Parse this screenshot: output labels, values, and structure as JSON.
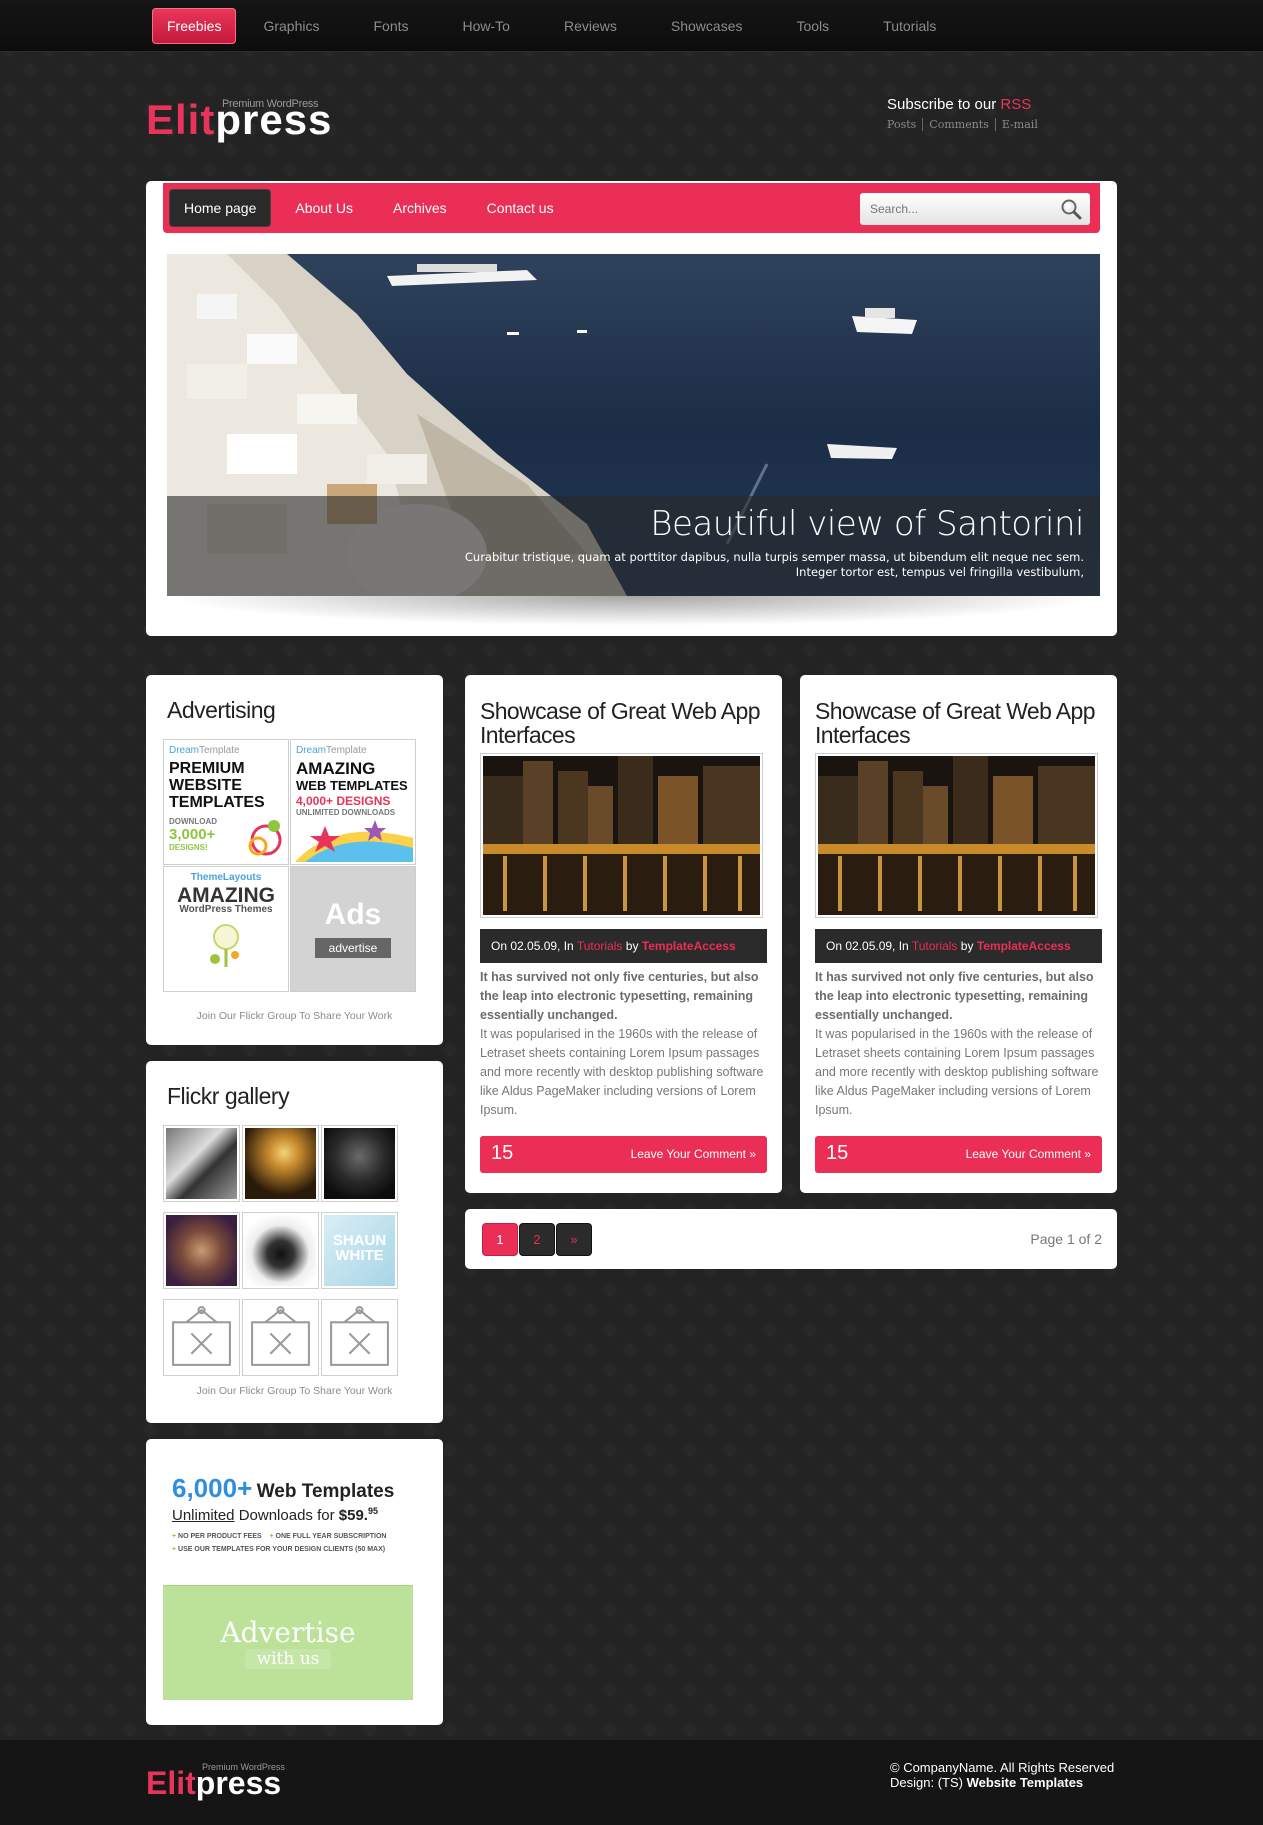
{
  "topnav": [
    "Freebies",
    "Graphics",
    "Fonts",
    "How-To",
    "Reviews",
    "Showcases",
    "Tools",
    "Tutorials"
  ],
  "logo": {
    "elit": "Elit",
    "press": "press",
    "tagline": "Premium WordPress"
  },
  "subscribe": {
    "title": "Subscribe to our",
    "rss": "RSS",
    "links": [
      "Posts",
      "Comments",
      "E-mail"
    ]
  },
  "mainnav": [
    "Home page",
    "About Us",
    "Archives",
    "Contact us"
  ],
  "search": {
    "placeholder": "Search..."
  },
  "slide": {
    "title": "Beautiful view of Santorini",
    "text": "Curabitur tristique, quam at porttitor dapibus, nulla turpis semper massa, ut bibendum elit neque nec sem. Integer tortor est, tempus vel fringilla vestibulum,"
  },
  "advertising": {
    "title": "Advertising",
    "ad1": {
      "brand": "Dream",
      "brand2": "Template",
      "line1": "PREMIUM",
      "line2": "WEBSITE",
      "line3": "TEMPLATES",
      "line4": "DOWNLOAD",
      "line5": "3,000+",
      "line6": "DESIGNS!"
    },
    "ad2": {
      "brand": "Dream",
      "brand2": "Template",
      "line1": "AMAZING",
      "line2": "WEB TEMPLATES",
      "line3": "4,000+ DESIGNS",
      "line4": "UNLIMITED DOWNLOADS"
    },
    "ad3": {
      "brand": "ThemeLayouts",
      "line1": "AMAZING",
      "line2": "WordPress Themes"
    },
    "ad4": {
      "word": "Ads",
      "button": "advertise"
    },
    "note": "Join Our Flickr Group To Share Your Work"
  },
  "flickr": {
    "title": "Flickr gallery",
    "note": "Join Our Flickr Group To Share Your Work",
    "thumb4_text": "SHAUN WHITE"
  },
  "promo": {
    "big": "6,000+",
    "big_rest": "Web Templates",
    "line2_u": "Unlimited",
    "line2": "Downloads for",
    "price": "$59.",
    "cents": "95",
    "bullets": [
      "NO PER PRODUCT FEES",
      "ONE FULL YEAR SUBSCRIPTION",
      "USE OUR TEMPLATES FOR YOUR DESIGN CLIENTS (50 MAX)"
    ],
    "adv1": "Advertise",
    "adv2": "with us"
  },
  "posts": [
    {
      "title": "Showcase of Great Web App Interfaces",
      "meta_on": "On 02.05.09, In",
      "meta_cat": "Tutorials",
      "meta_by": "by",
      "meta_author": "TemplateAccess",
      "bold": "It has survived not only five centuries, but also the leap into electronic typesetting, remaining essentially unchanged.",
      "text": "It was popularised in the 1960s with the release of Letraset sheets containing Lorem Ipsum passages and more recently with desktop publishing software like Aldus PageMaker including versions of Lorem Ipsum.",
      "count": "15",
      "comment": "Leave Your Comment »"
    },
    {
      "title": "Showcase of Great Web App Interfaces",
      "meta_on": "On 02.05.09, In",
      "meta_cat": "Tutorials",
      "meta_by": "by",
      "meta_author": "TemplateAccess",
      "bold": "It has survived not only five centuries, but also the leap into electronic typesetting, remaining essentially unchanged.",
      "text": "It was popularised in the 1960s with the release of Letraset sheets containing Lorem Ipsum passages and more recently with desktop publishing software like Aldus PageMaker including versions of Lorem Ipsum.",
      "count": "15",
      "comment": "Leave Your Comment »"
    }
  ],
  "pager": {
    "pages": [
      "1",
      "2",
      "»"
    ],
    "info": "Page 1 of 2"
  },
  "footer": {
    "elit": "Elit",
    "press": "press",
    "tagline": "Premium WordPress",
    "copy": "© CompanyName. All Rights Reserved",
    "design": "Design: (TS)",
    "design_link": "Website Templates"
  },
  "colors": {
    "accent": "#ea2e55",
    "dark": "#2b2b2b",
    "background": "#232323"
  }
}
